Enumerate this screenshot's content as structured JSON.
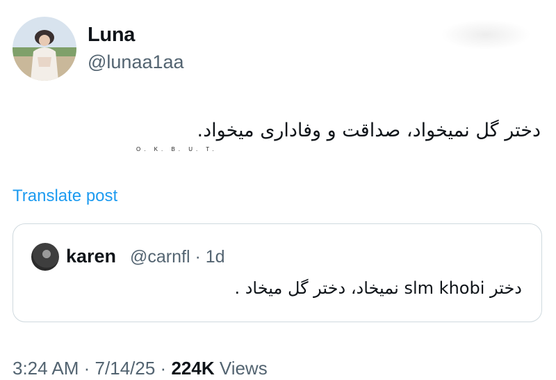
{
  "author": {
    "name": "Luna",
    "handle": "@lunaa1aa"
  },
  "tweet": {
    "text": "دختر گل نمیخواد، صداقت و وفاداری میخواد.",
    "caption": "O. K. B. U. T."
  },
  "translate_label": "Translate post",
  "quote": {
    "name": "karen",
    "handle": "@carnfl · 1d",
    "text": "دختر slm khobi نمیخاد، دختر گل میخاد ."
  },
  "meta": {
    "time": "3:24 AM",
    "date": "7/14/25",
    "views_count": "224K",
    "views_label": "Views",
    "sep": "·"
  },
  "colors": {
    "link": "#1d9bf0",
    "secondary": "#536471",
    "text": "#0f1419",
    "border": "#cfd9de"
  }
}
